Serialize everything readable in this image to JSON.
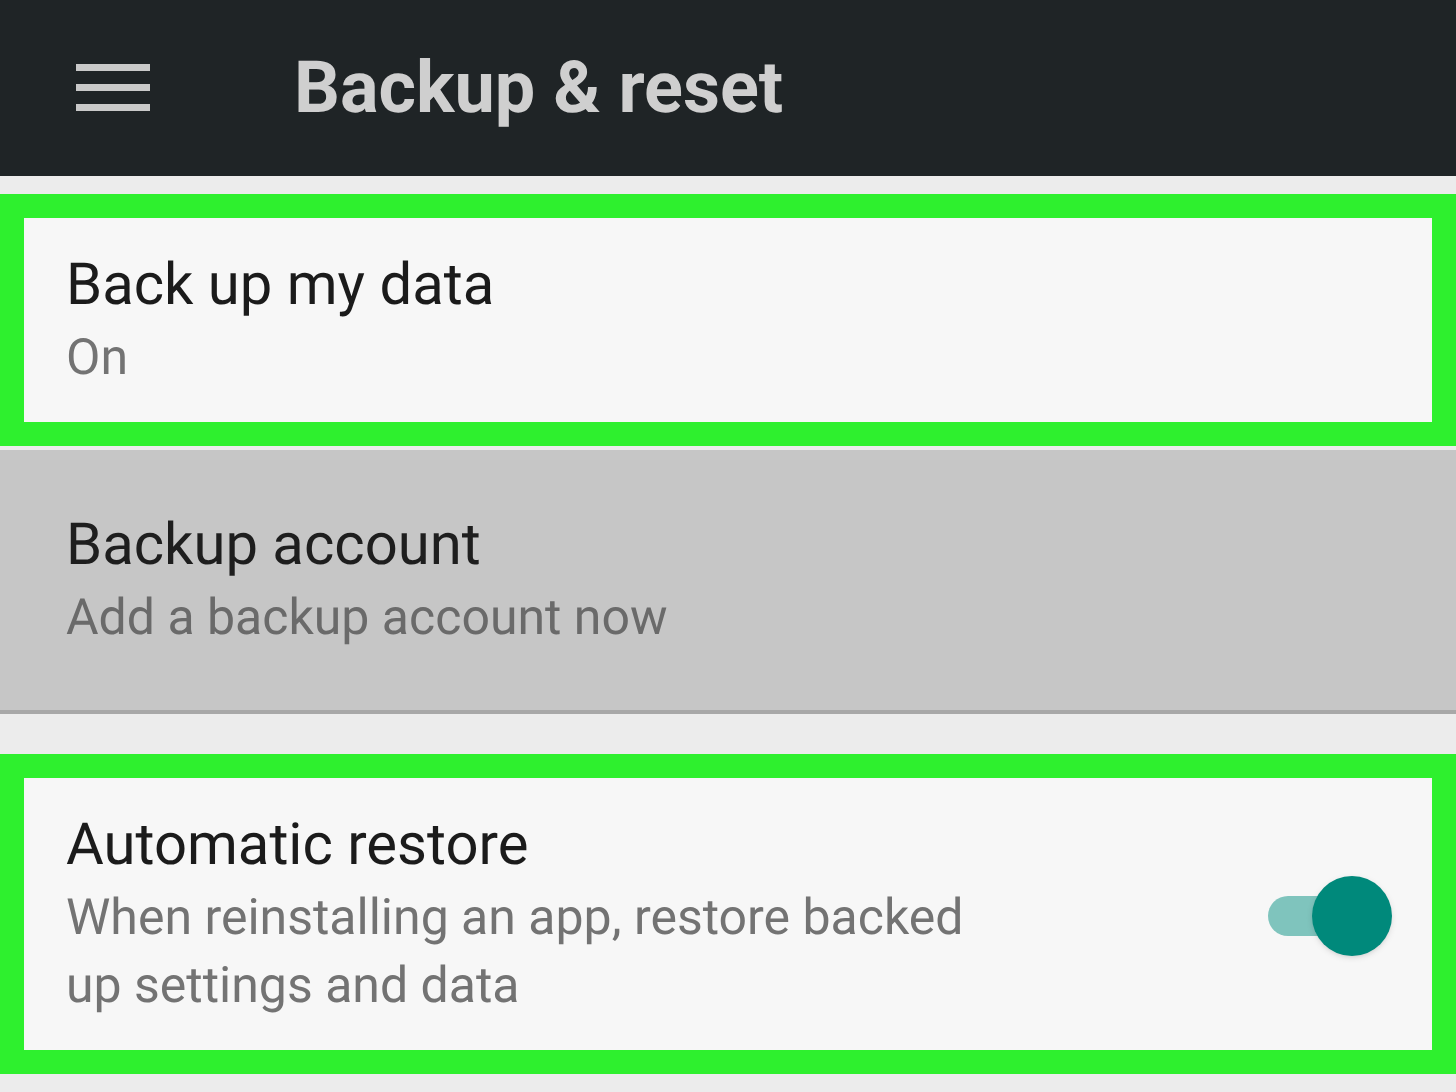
{
  "toolbar": {
    "title": "Backup & reset"
  },
  "settings": [
    {
      "kind": "text",
      "title": "Back up my data",
      "summary": "On",
      "disabled": false,
      "highlighted": true
    },
    {
      "kind": "text",
      "title": "Backup account",
      "summary": "Add a backup account now",
      "disabled": true,
      "highlighted": false
    },
    {
      "kind": "switch",
      "title": "Automatic restore",
      "summary": "When reinstalling an app, restore backed up settings and data",
      "disabled": false,
      "highlighted": true,
      "on": true
    }
  ]
}
